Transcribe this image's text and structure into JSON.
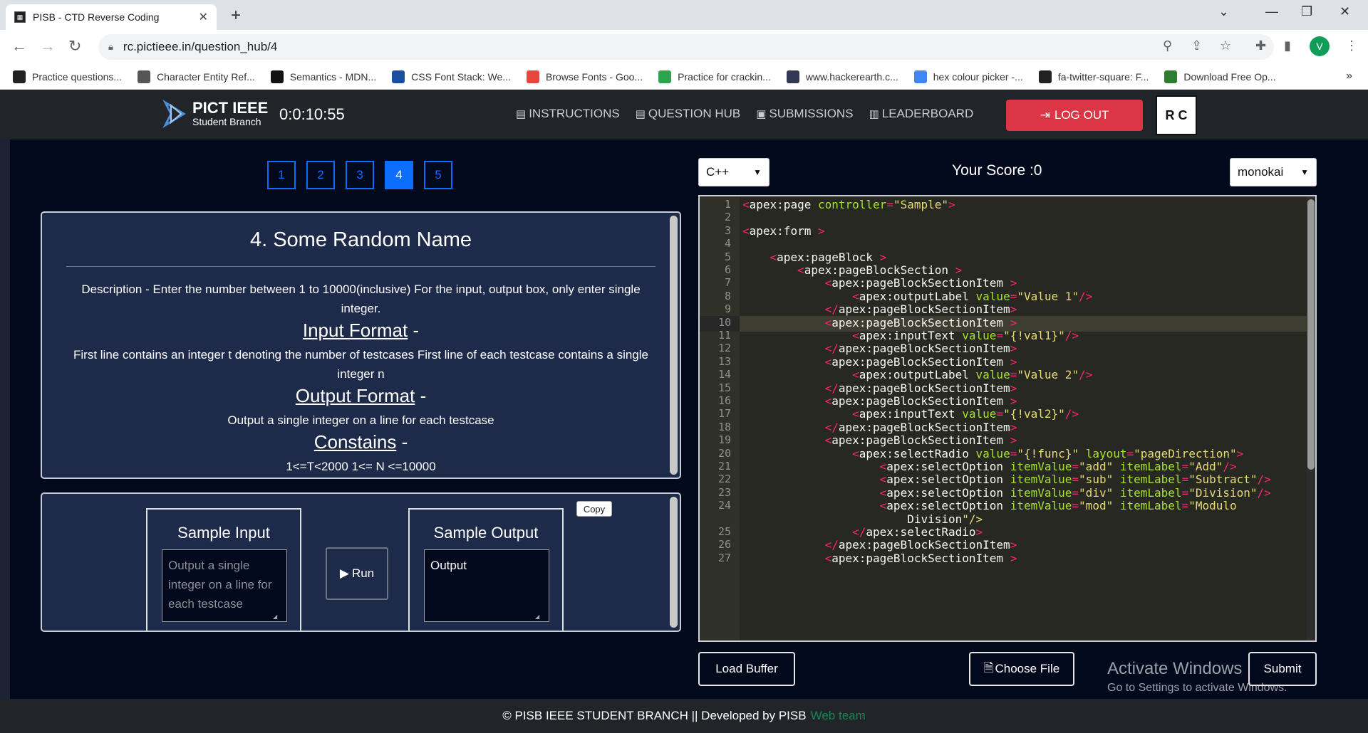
{
  "browser": {
    "tab_title": "PISB - CTD Reverse Coding",
    "url": "rc.pictieee.in/question_hub/4",
    "avatar_letter": "V",
    "bookmarks": [
      {
        "label": "Practice questions...",
        "color": "#222222"
      },
      {
        "label": "Character Entity Ref...",
        "color": "#555555"
      },
      {
        "label": "Semantics - MDN...",
        "color": "#111111"
      },
      {
        "label": "CSS Font Stack: We...",
        "color": "#1a4fa0"
      },
      {
        "label": "Browse Fonts - Goo...",
        "color": "#e8453c"
      },
      {
        "label": "Practice for crackin...",
        "color": "#2ea44f"
      },
      {
        "label": "www.hackerearth.c...",
        "color": "#323754"
      },
      {
        "label": "hex colour picker -...",
        "color": "#4285f4"
      },
      {
        "label": "fa-twitter-square: F...",
        "color": "#222222"
      },
      {
        "label": "Download Free Op...",
        "color": "#2e7d32"
      }
    ]
  },
  "header": {
    "logo_title": "PICT IEEE",
    "logo_subtitle": "Student Branch",
    "timer": "0:0:10:55",
    "nav": [
      {
        "icon": "instructions-icon",
        "label": "INSTRUCTIONS"
      },
      {
        "icon": "question-hub-icon",
        "label": "QUESTION HUB"
      },
      {
        "icon": "submissions-icon",
        "label": "SUBMISSIONS"
      },
      {
        "icon": "leaderboard-icon",
        "label": "LEADERBOARD"
      }
    ],
    "logout": "LOG OUT",
    "rc_logo_text": "R C"
  },
  "questions": {
    "tabs": [
      "1",
      "2",
      "3",
      "4",
      "5"
    ],
    "active": "4"
  },
  "question": {
    "title": "4. Some Random Name",
    "description": "Description - Enter the number between 1 to 10000(inclusive) For the input, output box, only enter single integer.",
    "input_heading": "Input Format",
    "input_text": "First line contains an integer t denoting the number of testcases First line of each testcase contains a single integer n",
    "output_heading": "Output Format",
    "output_text": "Output a single integer on a line for each testcase",
    "constraints_heading": "Constains",
    "constraints_text": "1<=T<2000 1<= N <=10000",
    "dash": "-"
  },
  "sample": {
    "input_heading": "Sample Input",
    "input_placeholder": "Output a single integer on a line for each testcase",
    "run_label": "Run",
    "output_heading": "Sample Output",
    "output_value": "Output",
    "copy_label": "Copy"
  },
  "editor": {
    "language": "C++",
    "score_label": "Your Score :0",
    "theme": "monokai",
    "line_numbers": [
      "1",
      "2",
      "3",
      "4",
      "5",
      "6",
      "7",
      "8",
      "9",
      "10",
      "11",
      "12",
      "13",
      "14",
      "15",
      "16",
      "17",
      "18",
      "19",
      "20",
      "21",
      "22",
      "23",
      "24",
      "",
      "25",
      "26",
      "27"
    ],
    "lines": [
      "<apex:page controller=\"Sample\">",
      "",
      "<apex:form >",
      "",
      "    <apex:pageBlock >",
      "        <apex:pageBlockSection >",
      "            <apex:pageBlockSectionItem >",
      "                <apex:outputLabel value=\"Value 1\"/>",
      "            </apex:pageBlockSectionItem>",
      "            <apex:pageBlockSectionItem >",
      "                <apex:inputText value=\"{!val1}\"/>",
      "            </apex:pageBlockSectionItem>",
      "            <apex:pageBlockSectionItem >",
      "                <apex:outputLabel value=\"Value 2\"/>",
      "            </apex:pageBlockSectionItem>",
      "            <apex:pageBlockSectionItem >",
      "                <apex:inputText value=\"{!val2}\"/>",
      "            </apex:pageBlockSectionItem>",
      "            <apex:pageBlockSectionItem >",
      "                <apex:selectRadio value=\"{!func}\" layout=\"pageDirection\">",
      "                    <apex:selectOption itemValue=\"add\" itemLabel=\"Add\"/>",
      "                    <apex:selectOption itemValue=\"sub\" itemLabel=\"Subtract\"/>",
      "                    <apex:selectOption itemValue=\"div\" itemLabel=\"Division\"/>",
      "                    <apex:selectOption itemValue=\"mod\" itemLabel=\"Modulo",
      "                        Division\"/>",
      "                </apex:selectRadio>",
      "            </apex:pageBlockSectionItem>",
      "            <apex:pageBlockSectionItem >"
    ],
    "load_buffer": "Load Buffer",
    "choose_file": "Choose File",
    "submit": "Submit"
  },
  "watermark": {
    "line1": "Activate Windows",
    "line2": "Go to Settings to activate Windows."
  },
  "footer": {
    "text": "© PISB IEEE STUDENT BRANCH || Developed by PISB",
    "link": "Web team"
  }
}
